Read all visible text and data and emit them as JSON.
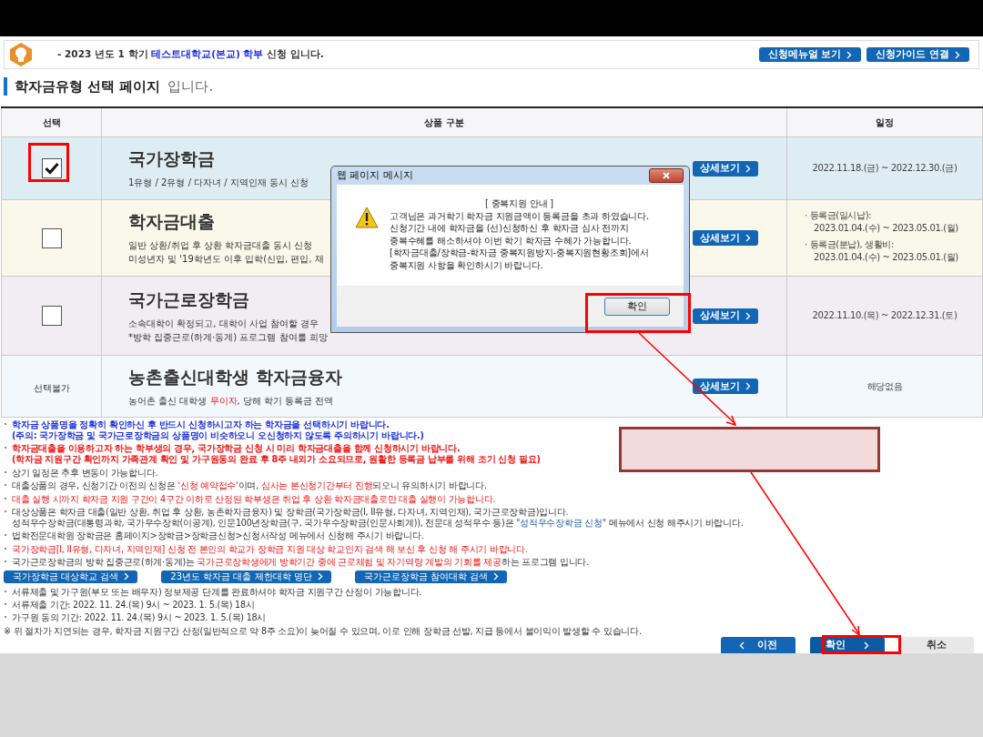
{
  "header": {
    "notice": [
      {
        "text": "- 2023 년도 1 학기 ",
        "kind": "plain"
      },
      {
        "text": "테스트대학교(본교) 학부",
        "kind": "info"
      },
      {
        "text": " 신청 입니다.",
        "kind": "plain"
      }
    ],
    "buttons": [
      "신청메뉴얼 보기",
      "신청가이드 연결"
    ]
  },
  "page_title": {
    "main": "학자금유형 선택 페이지",
    "suffix": "입니다."
  },
  "table": {
    "columns": [
      "선택",
      "상품 구분",
      "일정"
    ],
    "rows": [
      {
        "color": "#deedf3",
        "select": {
          "kind": "checkbox",
          "checked": true
        },
        "name": "국가장학금",
        "description": [
          [
            {
              "text": "1유형 / 2유형 / 다자녀 / 지역인재 동시 신청",
              "kind": "plain"
            }
          ]
        ],
        "detail_button": "상세보기",
        "schedule": [
          {
            "dates": "2022.11.18.(금) ~ 2022.12.30.(금)"
          }
        ]
      },
      {
        "color": "#faf8ea",
        "select": {
          "kind": "checkbox",
          "checked": false
        },
        "name": "학자금대출",
        "description": [
          [
            {
              "text": "일반 상환/취업 후 상환 학자금대출 동시 신청",
              "kind": "plain"
            }
          ],
          [
            {
              "text": "미성년자 및 '19학년도 이후 입학(신입, 편입, 재",
              "kind": "plain"
            }
          ]
        ],
        "detail_button": "상세보기",
        "schedule": [
          {
            "label": "· 등록금(일시납):",
            "dates": "2023.01.04.(수) ~ 2023.05.01.(월)"
          },
          {
            "label": "· 등록금(분납), 생활비:",
            "dates": "2023.01.04.(수) ~ 2023.05.01.(월)"
          }
        ]
      },
      {
        "color": "#f2ecf3",
        "select": {
          "kind": "checkbox",
          "checked": false
        },
        "name": "국가근로장학금",
        "description": [
          [
            {
              "text": "소속대학이 확정되고, 대학이 사업 참여할 경우",
              "kind": "plain"
            }
          ],
          [
            {
              "text": "*방학 집중근로(하계·동계) 프로그램 참여를 희망",
              "kind": "plain"
            }
          ]
        ],
        "detail_button": "상세보기",
        "schedule": [
          {
            "dates": "2022.11.10.(목) ~ 2022.12.31.(토)"
          }
        ]
      },
      {
        "color": "#f3f8fd",
        "select": {
          "kind": "unavailable",
          "label": "선택불가"
        },
        "name": "농촌출신대학생 학자금융자",
        "description": [
          [
            {
              "text": "농어촌 출신 대학생 ",
              "kind": "plain"
            },
            {
              "text": "무이자",
              "kind": "alert"
            },
            {
              "text": ", 당해 학기 등록금 전액",
              "kind": "plain"
            }
          ]
        ],
        "detail_button": "상세보기",
        "schedule": [
          {
            "dates": "해당없음"
          }
        ]
      }
    ]
  },
  "notes": [
    {
      "kind": "note",
      "bold": true,
      "lines": [
        [
          {
            "text": "학자금 상품명을 정확히 확인하신 후 반드시 신청하시고자 하는 학자금을 선택하시기 바랍니다.",
            "kind": "info"
          }
        ],
        [
          {
            "text": "(주의: 국가장학금 및 국가근로장학금의 상품명이 비슷하오니 오신청하지 않도록 주의하시기 바랍니다.)",
            "kind": "info"
          }
        ]
      ]
    },
    {
      "kind": "note",
      "bold": true,
      "lines": [
        [
          {
            "text": "학자금대출을 이용하고자 하는 학부생의 경우, 국가장학금 신청 시 미리 학자금대출을 함께 신청하시기 바랍니다.",
            "kind": "alert"
          }
        ],
        [
          {
            "text": "(학자금 지원구간 확인까지 가족관계 확인 및 가구원동의 완료 후 8주 내외가 소요되므로, 원활한 등록금 납부를 위해 조기 신청 필요)",
            "kind": "alert"
          }
        ]
      ]
    },
    {
      "kind": "note",
      "bold": false,
      "lines": [
        [
          {
            "text": "상기 일정은 추후 변동이 가능합니다.",
            "kind": "plain"
          }
        ]
      ]
    },
    {
      "kind": "note",
      "bold": false,
      "lines": [
        [
          {
            "text": "대출상품의 경우, 신청기간 이전의 신청은 ",
            "kind": "plain"
          },
          {
            "text": "'신청 예약접수'",
            "kind": "alert"
          },
          {
            "text": "이며, ",
            "kind": "plain"
          },
          {
            "text": "심사는 본신청기간부터 진행",
            "kind": "alert"
          },
          {
            "text": "되오니 유의하시기 바랍니다.",
            "kind": "plain"
          }
        ]
      ]
    },
    {
      "kind": "note",
      "bold": false,
      "lines": [
        [
          {
            "text": "대출 실행 시까지 학자금 지원 구간이 4구간 이하로 산정된 학부생은 취업 후 상환 학자금대출로만 대출 실행이 가능합니다.",
            "kind": "alert"
          }
        ]
      ]
    },
    {
      "kind": "note",
      "bold": false,
      "lines": [
        [
          {
            "text": "대상상품은 학자금 대출(일반 상환, 취업 후 상환, 농촌학자금융자) 및 장학금(국가장학금(I, II유형, 다자녀, 지역인재), 국가근로장학금)입니다.",
            "kind": "plain"
          }
        ],
        [
          {
            "text": "성적우수장학금(대통령과학, 국가우수장학(이공계), 인문100년장학금(구, 국가우수장학금(인문사회계)), 전문대 성적우수 등)은 ",
            "kind": "plain"
          },
          {
            "text": "\"성적우수장학금 신청\"",
            "kind": "link"
          },
          {
            "text": " 메뉴에서 신청 해주시기 바랍니다.",
            "kind": "plain"
          }
        ]
      ]
    },
    {
      "kind": "note",
      "bold": false,
      "lines": [
        [
          {
            "text": "법학전문대학원 장학금은 홈페이지>장학금>장학금신청>신청서작성 메뉴에서 신청해 주시기 바랍니다.",
            "kind": "plain"
          }
        ]
      ]
    },
    {
      "kind": "note",
      "bold": false,
      "lines": [
        [
          {
            "text": "국가장학금[I, II유형, 다자녀, 지역인재] 신청 전 본인의 학교가 장학금 지원 대상 학교인지 검색 해 보신 후 신청 해 주시기 바랍니다.",
            "kind": "alert"
          }
        ]
      ]
    },
    {
      "kind": "note",
      "bold": false,
      "lines": [
        [
          {
            "text": "국가근로장학금의 방학 집중근로(하계·동계)는 ",
            "kind": "plain"
          },
          {
            "text": "국가근로장학생에게 방학기간 중에 근로체험 및 자기역량 계발의 기회를 제공",
            "kind": "alert"
          },
          {
            "text": "하는 프로그램 입니다.",
            "kind": "plain"
          }
        ]
      ]
    },
    {
      "kind": "links",
      "buttons": [
        "국가장학금 대상학교 검색",
        "23년도 학자금 대출 제한대학 명단",
        "국가근로장학금 참여대학 검색"
      ]
    },
    {
      "kind": "note",
      "bold": false,
      "lines": [
        [
          {
            "text": "서류제출 및 가구원(부모 또는 배우자) 정보제공 단계를 완료하셔야 학자금 지원구간 산정이 가능합니다.",
            "kind": "plain"
          }
        ]
      ]
    },
    {
      "kind": "note",
      "bold": false,
      "lines": [
        [
          {
            "text": "서류제출 기간: 2022. 11. 24.(목) 9시 ~ 2023. 1. 5.(목) 18시",
            "kind": "plain"
          }
        ]
      ]
    },
    {
      "kind": "note",
      "bold": false,
      "lines": [
        [
          {
            "text": "가구원 동의 기간: 2022. 11. 24.(목) 9시 ~ 2023. 1. 5.(목) 18시",
            "kind": "plain"
          }
        ]
      ]
    },
    {
      "kind": "remark",
      "bold": false,
      "lines": [
        [
          {
            "text": "※ 위 절차가 지연되는 경우, 학자금 지원구간 산정(일반적으로 약 8주 소요)이 늦어질 수 있으며, 이로 인해 장학금 선발, 지급 등에서 불이익이 발생할 수 있습니다.",
            "kind": "plain"
          }
        ]
      ]
    }
  ],
  "footer_buttons": [
    {
      "kind": "prev",
      "label": "이전"
    },
    {
      "kind": "next",
      "label": "확인"
    },
    {
      "kind": "cancel",
      "label": "취소"
    }
  ],
  "dialog": {
    "title": "웹 페이지 메시지",
    "heading": "[ 중복지원 안내 ]",
    "lines": [
      "고객님은 과거학기 학자금 지원금액이 등록금을 초과 하였습니다.",
      "신청기간 내에 학자금을 (선)신청하신 후 학자금 심사 전까지",
      "중복수혜를 해소하셔야 이번 학기 학자금 수혜가 가능합니다.",
      "[학자금대출/장학금-학자금 중복지원방지-중복지원현황조회]에서",
      "중복지원 사항을 확인하시기 바랍니다."
    ],
    "button": "확인"
  }
}
